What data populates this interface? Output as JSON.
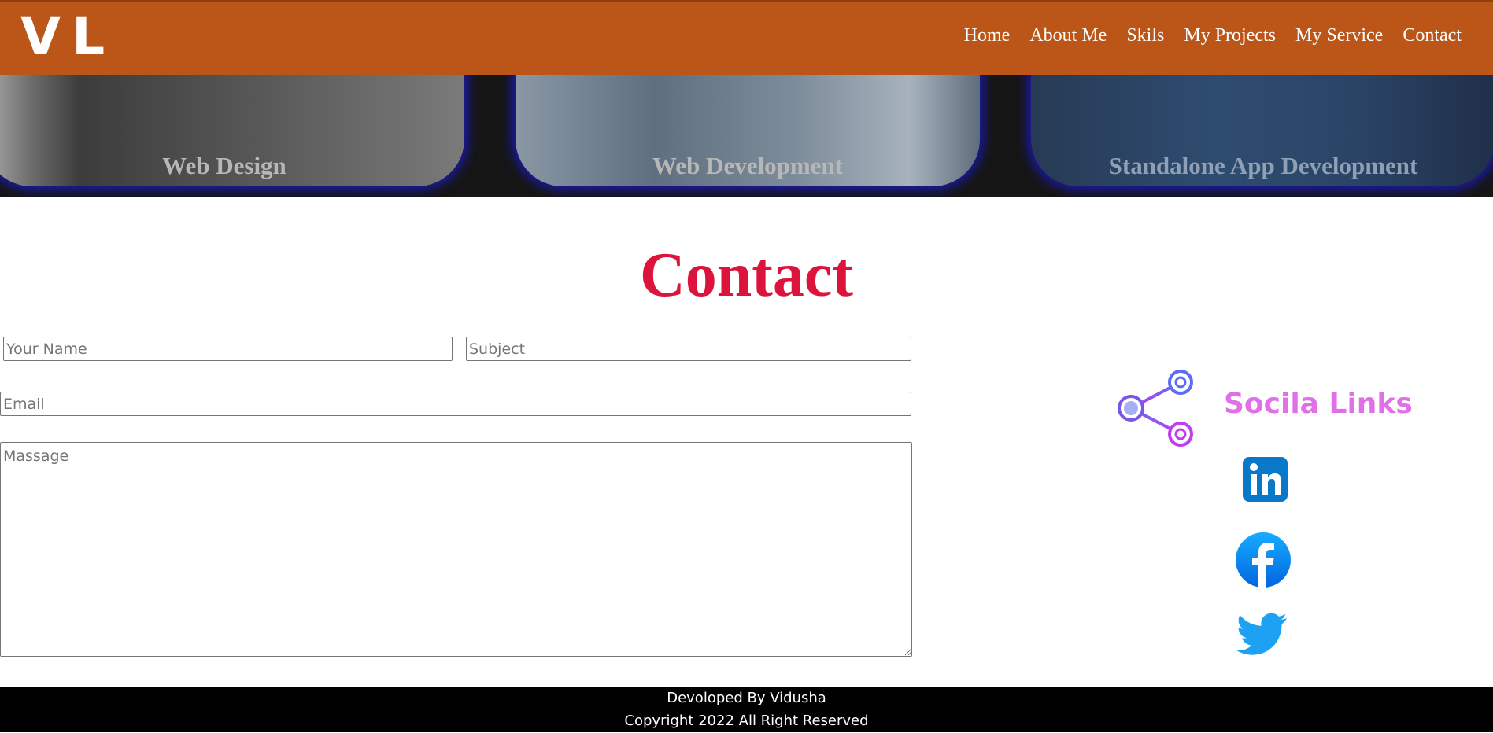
{
  "header": {
    "logo": "VL",
    "nav": [
      "Home",
      "About Me",
      "Skils",
      "My Projects",
      "My Service",
      "Contact"
    ],
    "background": "#bb5518"
  },
  "services": {
    "cards": [
      "Web Design",
      "Web Development",
      "Standalone App Development"
    ]
  },
  "contact": {
    "title": "Contact",
    "title_color": "#dc143c",
    "name_placeholder": "Your Name",
    "subject_placeholder": "Subject",
    "email_placeholder": "Email",
    "message_placeholder": "Massage"
  },
  "social": {
    "title": "Socila Links",
    "icons": [
      "share-network-icon",
      "linkedin-icon",
      "facebook-icon",
      "twitter-icon"
    ]
  },
  "footer": {
    "line1": "Devoloped By Vidusha",
    "line2": "Copyright 2022 All Right Reserved"
  }
}
